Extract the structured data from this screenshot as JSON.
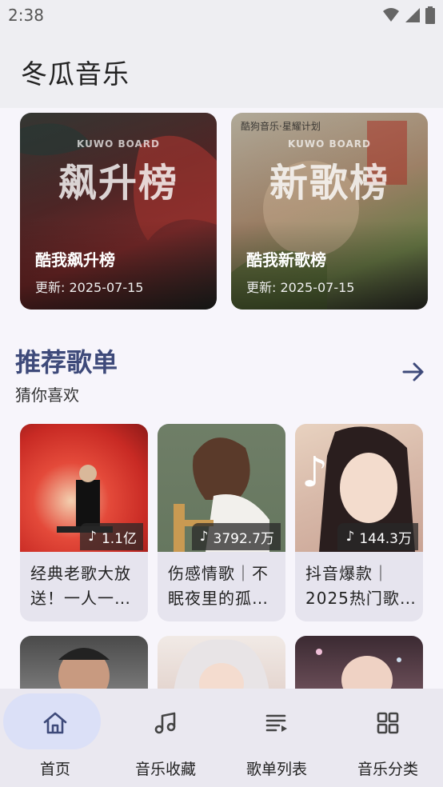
{
  "status": {
    "time": "2:38"
  },
  "app": {
    "title": "冬瓜音乐"
  },
  "boards": [
    {
      "kuwo": "KUWO BOARD",
      "big": "飙升榜",
      "name": "酷我飙升榜",
      "update": "更新: 2025-07-15",
      "tag": ""
    },
    {
      "kuwo": "KUWO BOARD",
      "big": "新歌榜",
      "name": "酷我新歌榜",
      "update": "更新: 2025-07-15",
      "tag": "酷狗音乐·星耀计划"
    }
  ],
  "section": {
    "title": "推荐歌单",
    "subtitle": "猜你喜欢"
  },
  "playlists": [
    {
      "count": "1.1亿",
      "title": "经典老歌大放送！一人一…"
    },
    {
      "count": "3792.7万",
      "title": "伤感情歌｜不眠夜里的孤…"
    },
    {
      "count": "144.3万",
      "title": "抖音爆款｜2025热门歌…"
    }
  ],
  "nav": [
    {
      "label": "首页",
      "icon": "home-icon",
      "active": true
    },
    {
      "label": "音乐收藏",
      "icon": "music-note-icon",
      "active": false
    },
    {
      "label": "歌单列表",
      "icon": "playlist-icon",
      "active": false
    },
    {
      "label": "音乐分类",
      "icon": "grid-icon",
      "active": false
    }
  ],
  "colors": {
    "accent": "#3e4a7a",
    "nav_active": "#dbe0f7"
  }
}
